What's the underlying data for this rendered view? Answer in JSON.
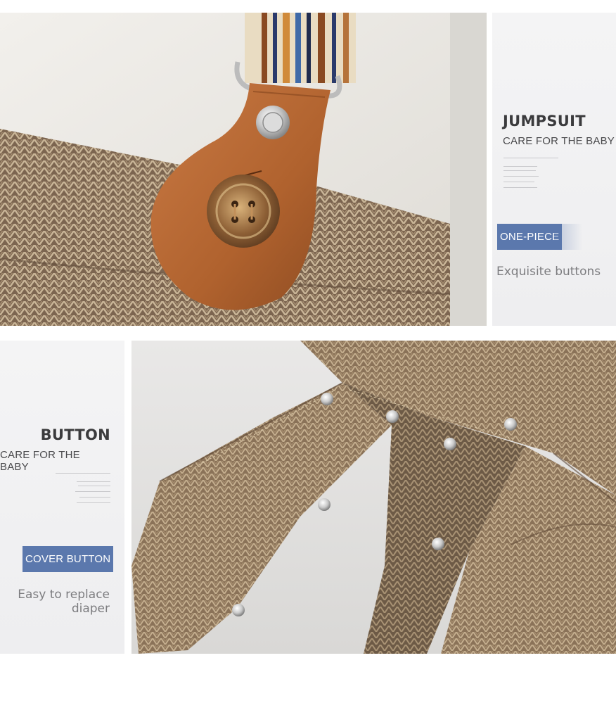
{
  "section_jumpsuit": {
    "title": "JUMPSUIT",
    "subtitle": "CARE FOR THE BABY",
    "badge": "ONE-PIECE",
    "feature": "Exquisite buttons"
  },
  "section_button": {
    "title": "BUTTON",
    "subtitle": "CARE FOR THE BABY",
    "badge": "COVER BUTTON",
    "feature_line1": "Easy to replace",
    "feature_line2": "diaper"
  },
  "colors": {
    "badge_bg": "#5b78ad",
    "title_text": "#3b3b3d",
    "feature_text": "#7d7d80",
    "panel_bg": "#f2f2f3",
    "leather": "#b86a36",
    "herringbone": "#8a6f55"
  },
  "icons": {
    "photo1": "suspender-leather-tab-photo",
    "photo2": "snap-button-crotch-photo"
  }
}
